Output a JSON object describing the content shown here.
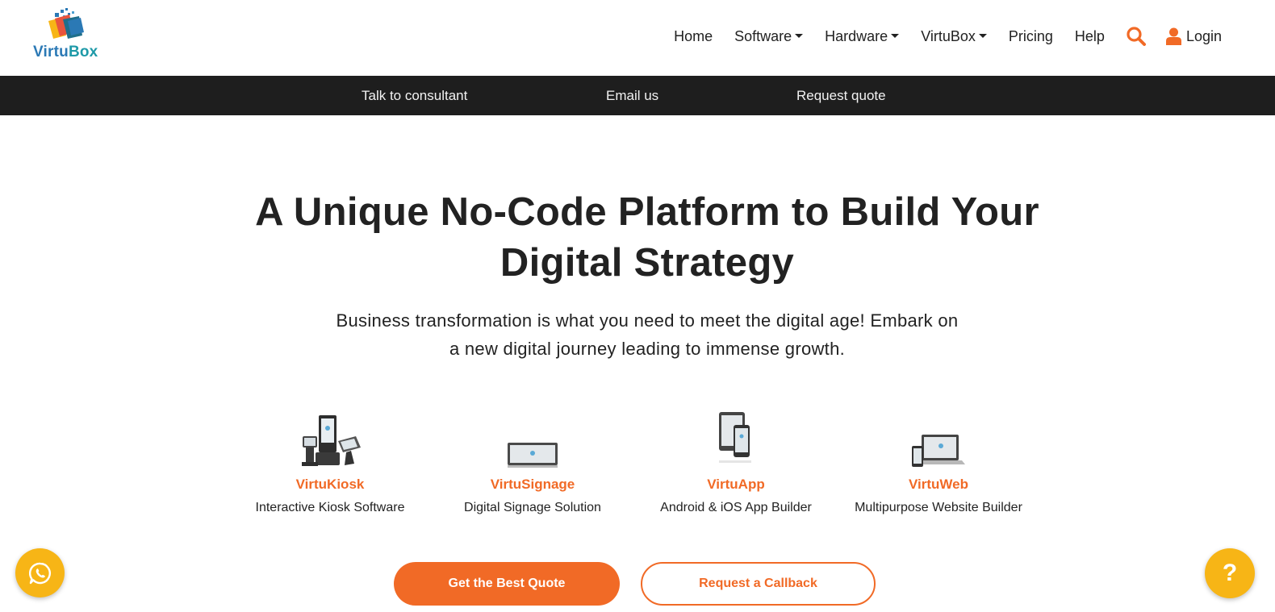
{
  "brand": {
    "name_part1": "Virtu",
    "name_part2": "Box"
  },
  "nav": {
    "home": "Home",
    "software": "Software",
    "hardware": "Hardware",
    "virtubox": "VirtuBox",
    "pricing": "Pricing",
    "help": "Help",
    "login": "Login"
  },
  "contact_bar": {
    "consultant": "Talk to consultant",
    "email": "Email us",
    "quote": "Request quote"
  },
  "hero": {
    "title_line1": "A Unique No-Code Platform to Build Your",
    "title_line2": "Digital Strategy",
    "subtitle_line1": "Business transformation is what you need to meet the digital age! Embark on",
    "subtitle_line2": "a new digital journey leading to immense growth."
  },
  "products": [
    {
      "name": "VirtuKiosk",
      "desc": "Interactive Kiosk Software",
      "icon": "kiosk-icon"
    },
    {
      "name": "VirtuSignage",
      "desc": "Digital Signage Solution",
      "icon": "signage-icon"
    },
    {
      "name": "VirtuApp",
      "desc": "Android & iOS App Builder",
      "icon": "app-devices-icon"
    },
    {
      "name": "VirtuWeb",
      "desc": "Multipurpose Website Builder",
      "icon": "web-devices-icon"
    }
  ],
  "cta": {
    "quote": "Get the Best Quote",
    "callback": "Request a Callback"
  },
  "floating": {
    "help_symbol": "?"
  },
  "colors": {
    "accent": "#f16a26",
    "bar": "#1e1e1e",
    "fab": "#f7b516",
    "brand_blue": "#2b79b5"
  }
}
